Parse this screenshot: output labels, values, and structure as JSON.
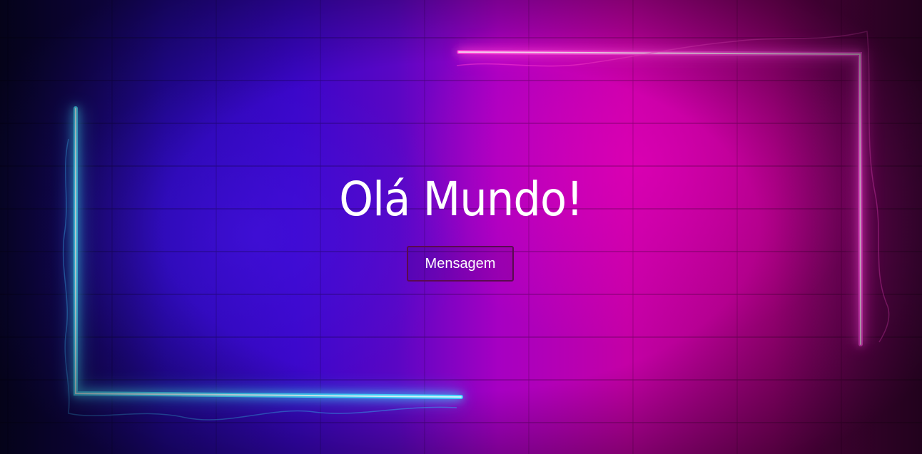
{
  "hero": {
    "title": "Olá Mundo!",
    "button_label": "Mensagem"
  },
  "colors": {
    "neon_blue": "#3ad8ff",
    "neon_pink": "#ff2fd6",
    "text": "#ffffff",
    "button_border": "#5a0a50"
  }
}
